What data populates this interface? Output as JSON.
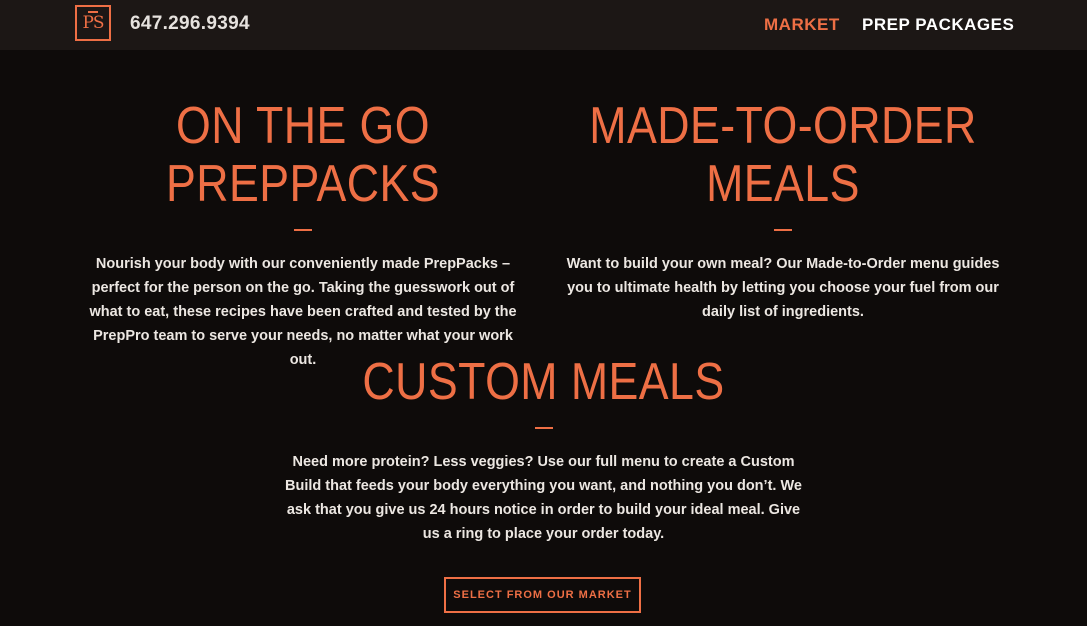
{
  "header": {
    "logo_text": "PS",
    "phone": "647.296.9394",
    "nav": {
      "market": "MARKET",
      "prep_packages": "PREP PACKAGES"
    }
  },
  "sections": {
    "preppacks": {
      "title": "ON THE GO PREPPACKS",
      "body": "Nourish your body with our conveniently made PrepPacks – perfect for the person on the go. Taking the guesswork out of what to eat, these recipes have been crafted and tested by the PrepPro team to serve your needs, no matter what your work out."
    },
    "made_to_order": {
      "title_line1": "MADE-TO-ORDER",
      "title_line2": "MEALS",
      "body": "Want to build your own meal? Our Made-to-Order menu guides you to ultimate health by letting you choose your fuel from our daily list of ingredients."
    },
    "custom_meals": {
      "title": "CUSTOM MEALS",
      "body": "Need more protein? Less veggies? Use our full menu to create a Custom Build that feeds your body everything you want, and nothing you don’t. We ask that you give us 24 hours notice in order to build your ideal meal. Give us a ring to place your order today."
    }
  },
  "cta": {
    "label": "SELECT FROM OUR MARKET"
  },
  "colors": {
    "accent": "#ee6f45",
    "background": "#0e0b0a",
    "header_bg": "#1c1715",
    "text": "#ece7e2"
  }
}
